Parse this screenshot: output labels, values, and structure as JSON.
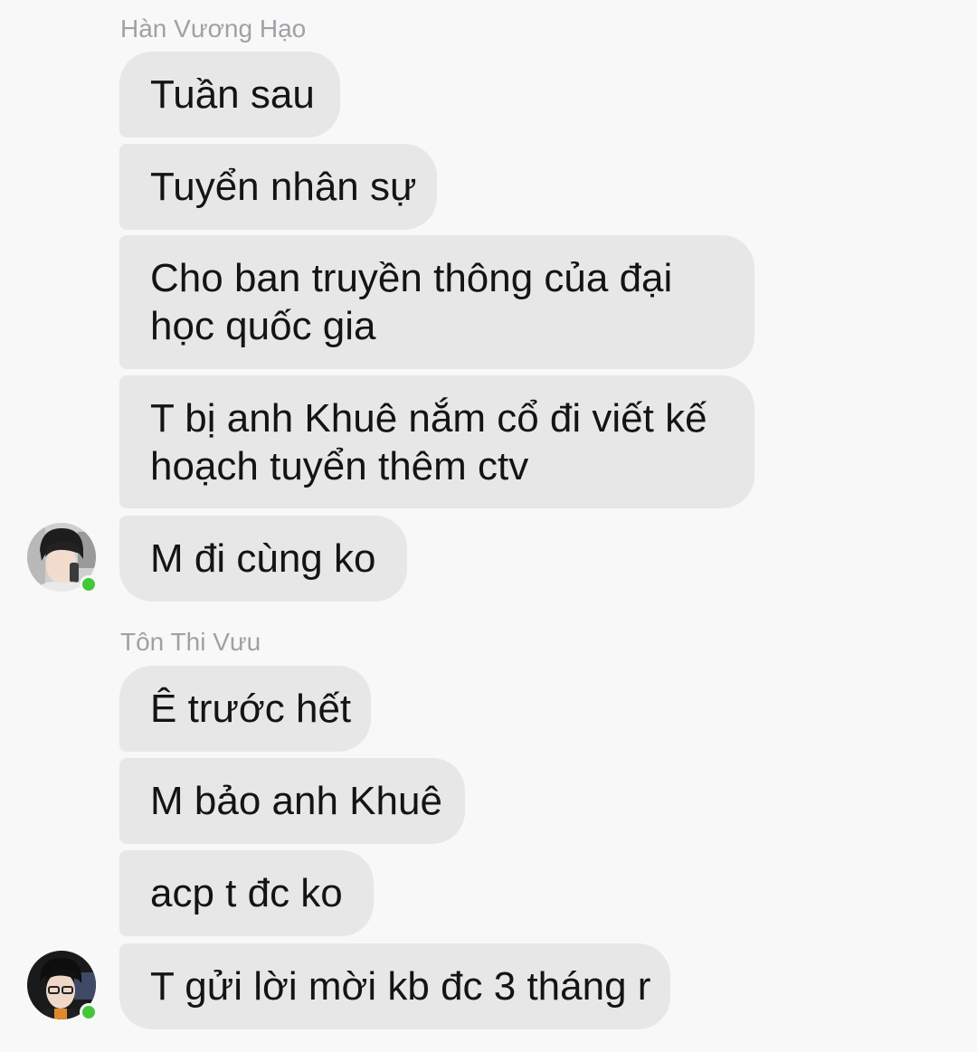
{
  "groups": [
    {
      "sender": "Hàn Vương Hạo",
      "messages": [
        [
          "Tuần sau"
        ],
        [
          "Tuyển nhân sự"
        ],
        [
          "Cho ban truyền thông của đại",
          "học quốc gia"
        ],
        [
          "T bị anh Khuê nắm cổ đi viết kế",
          "hoạch tuyển thêm ctv"
        ],
        [
          "M đi cùng ko"
        ]
      ]
    },
    {
      "sender": "Tôn Thi Vưu",
      "messages": [
        [
          "Ê trước hết"
        ],
        [
          "M bảo anh Khuê"
        ],
        [
          "acp t đc ko"
        ],
        [
          "T gửi lời mời kb đc 3 tháng r"
        ]
      ]
    }
  ],
  "colors": {
    "background": "#f8f8f8",
    "bubble": "#e7e7e8",
    "sender_name": "#9ea1a6",
    "online": "#44c73b"
  }
}
